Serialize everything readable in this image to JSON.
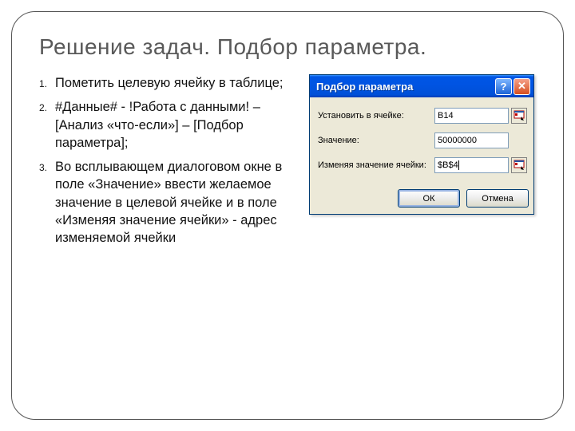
{
  "title": "Решение задач. Подбор параметра.",
  "steps": {
    "n1": "1.",
    "t1": "Пометить целевую ячейку в таблице;",
    "n2": "2.",
    "t2": "#Данные# - !Работа с данными! – [Анализ «что-если»] – [Подбор параметра];",
    "n3": "3.",
    "t3": "Во всплывающем диалоговом окне в поле «Значение» ввести желаемое значение в целевой ячейке и в поле «Изменяя значение ячейки» - адрес изменяемой ячейки"
  },
  "dialog": {
    "title": "Подбор параметра",
    "label_set_cell": "Установить в ячейке:",
    "label_value": "Значение:",
    "label_changing": "Изменяя значение ячейки:",
    "val_set_cell": "B14",
    "val_value": "50000000",
    "val_changing": "$B$4",
    "ok": "ОК",
    "cancel": "Отмена",
    "help_glyph": "?",
    "close_glyph": "✕"
  }
}
